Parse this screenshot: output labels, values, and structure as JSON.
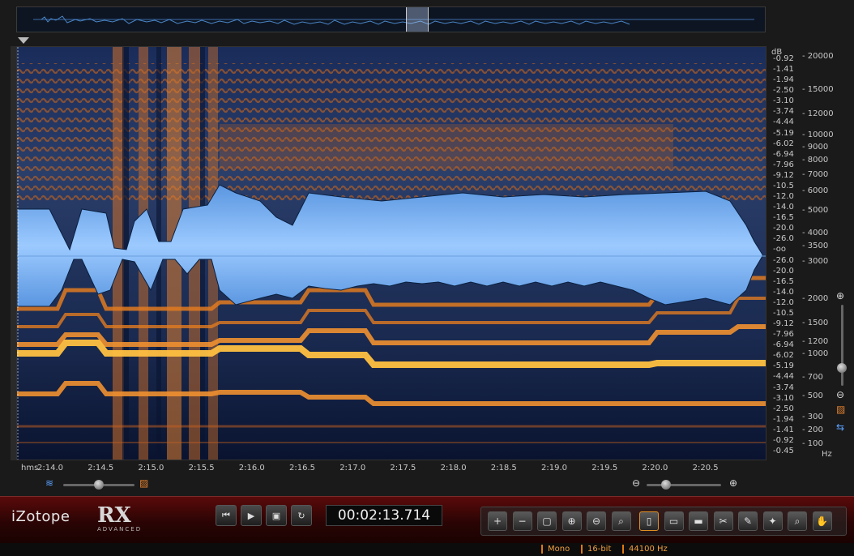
{
  "app": {
    "brand": "iZotope",
    "product": "RX",
    "edition": "ADVANCED"
  },
  "timecode": "00:02:13.714",
  "time_axis": {
    "unit": "hms",
    "ticks": [
      "2:14.0",
      "2:14.5",
      "2:15.0",
      "2:15.5",
      "2:16.0",
      "2:16.5",
      "2:17.0",
      "2:17.5",
      "2:18.0",
      "2:18.5",
      "2:19.0",
      "2:19.5",
      "2:20.0",
      "2:20.5"
    ]
  },
  "db_scale": {
    "unit": "dB",
    "ticks": [
      "-0.92",
      "-1.41",
      "-1.94",
      "-2.50",
      "-3.10",
      "-3.74",
      "-4.44",
      "-5.19",
      "-6.02",
      "-6.94",
      "-7.96",
      "-9.12",
      "-10.5",
      "-12.0",
      "-14.0",
      "-16.5",
      "-20.0",
      "-26.0",
      "-oo",
      "-26.0",
      "-20.0",
      "-16.5",
      "-14.0",
      "-12.0",
      "-10.5",
      "-9.12",
      "-7.96",
      "-6.94",
      "-6.02",
      "-5.19",
      "-4.44",
      "-3.74",
      "-3.10",
      "-2.50",
      "-1.94",
      "-1.41",
      "-0.92",
      "-0.45"
    ]
  },
  "hz_scale": {
    "unit": "Hz",
    "ticks": [
      "20000",
      "15000",
      "12000",
      "10000",
      "9000",
      "8000",
      "7000",
      "6000",
      "5000",
      "4000",
      "3500",
      "3000",
      "2000",
      "1500",
      "1200",
      "1000",
      "700",
      "500",
      "300",
      "200",
      "100"
    ]
  },
  "transport": {
    "buttons": [
      {
        "name": "go-to-start-button",
        "icon": "skip-back-icon",
        "glyph": "⏮"
      },
      {
        "name": "play-button",
        "icon": "play-icon",
        "glyph": "▶"
      },
      {
        "name": "play-selection-button",
        "icon": "play-selection-icon",
        "glyph": "▣"
      },
      {
        "name": "loop-button",
        "icon": "loop-icon",
        "glyph": "↻"
      }
    ]
  },
  "toolbar": {
    "tools": [
      {
        "name": "zoom-in-button",
        "glyph": "+"
      },
      {
        "name": "zoom-out-button",
        "glyph": "−"
      },
      {
        "name": "zoom-selection-button",
        "glyph": "▢"
      },
      {
        "name": "zoom-time-in-button",
        "glyph": "⊕"
      },
      {
        "name": "zoom-time-out-button",
        "glyph": "⊖"
      },
      {
        "name": "zoom-freq-button",
        "glyph": "⌕"
      },
      {
        "name": "time-selection-tool",
        "glyph": "▯",
        "active": true
      },
      {
        "name": "rect-selection-tool",
        "glyph": "▭"
      },
      {
        "name": "freq-selection-tool",
        "glyph": "▬"
      },
      {
        "name": "lasso-tool",
        "glyph": "✂"
      },
      {
        "name": "brush-tool",
        "glyph": "✎"
      },
      {
        "name": "magic-wand-tool",
        "glyph": "✦"
      },
      {
        "name": "magnifier-tool",
        "glyph": "⌕"
      },
      {
        "name": "hand-tool",
        "glyph": "✋"
      }
    ]
  },
  "status": {
    "channels": "Mono",
    "bit_depth": "16-bit",
    "sample_rate": "44100 Hz"
  },
  "colors": {
    "accent": "#e07a10",
    "spectrogram_low": "#0a1a3a",
    "spectrogram_high": "#ffb040",
    "waveform": "#7ab4f0"
  }
}
